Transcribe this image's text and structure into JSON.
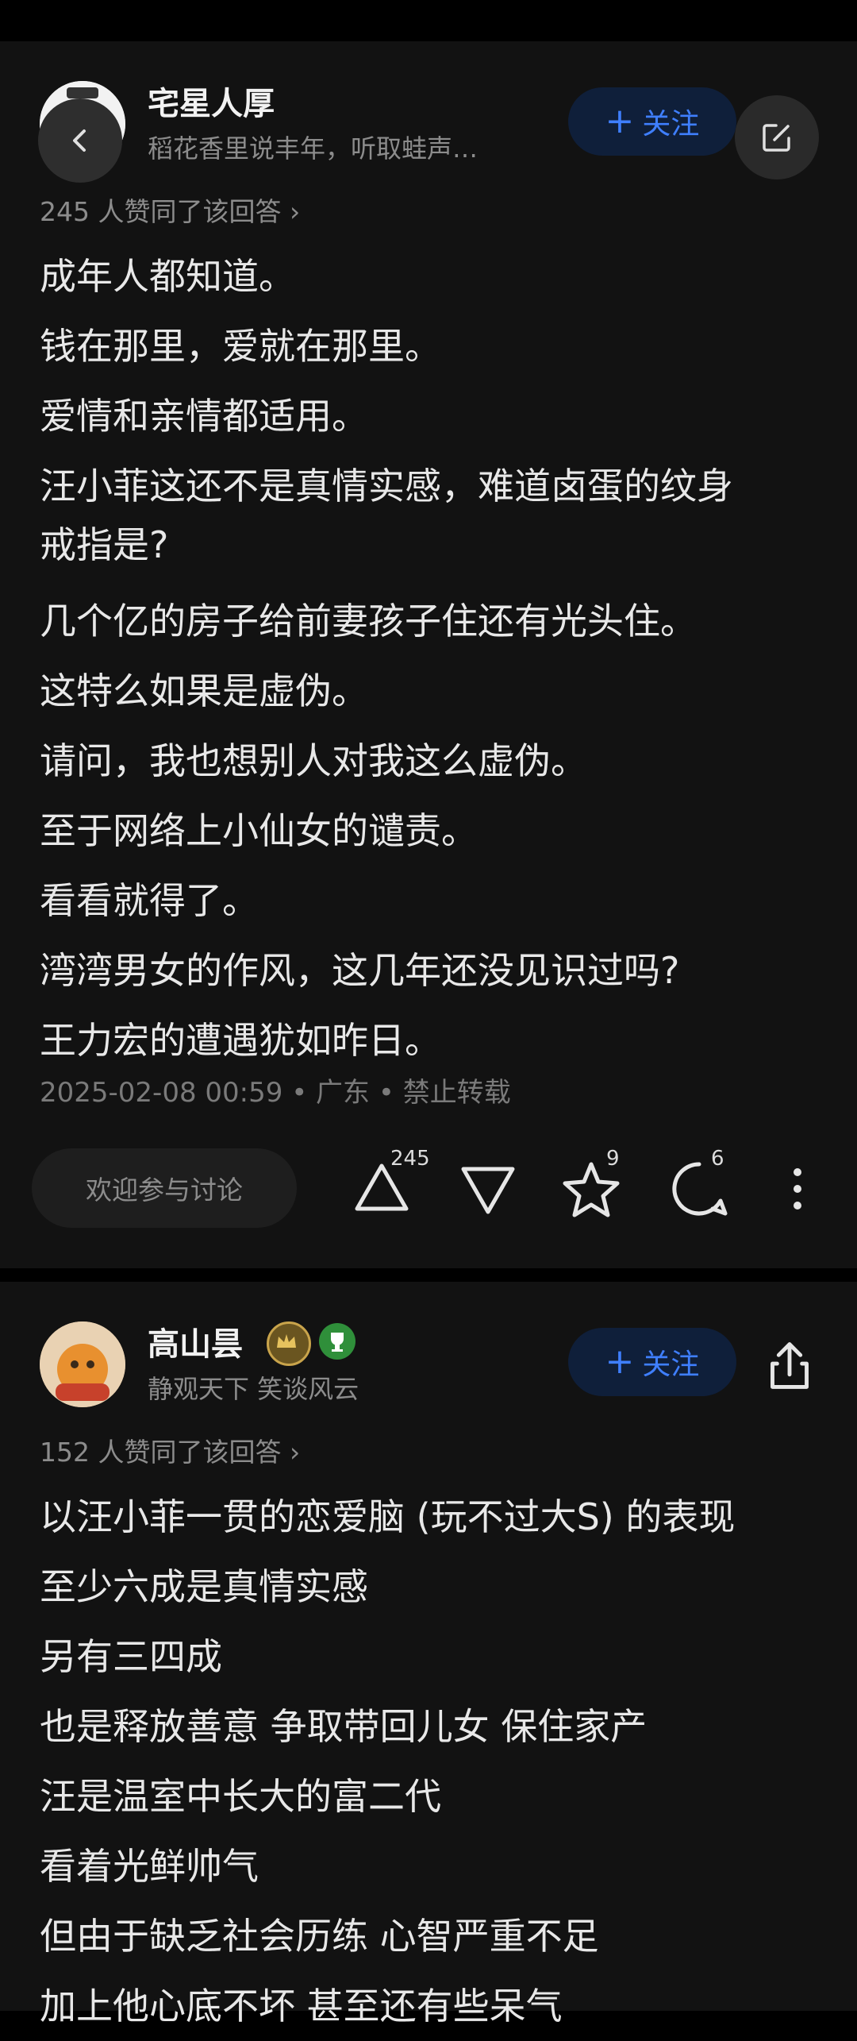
{
  "answer1": {
    "author_name": "宅星人厚",
    "author_bio": "稻花香里说丰年，听取蛙声…",
    "follow_label": "关注",
    "likes_text": "245 人赞同了该回答 ›",
    "lines": [
      "成年人都知道。",
      "钱在那里，爱就在那里。",
      "爱情和亲情都适用。",
      "汪小菲这还不是真情实感，难道卤蛋的纹身",
      "戒指是?",
      "几个亿的房子给前妻孩子住还有光头住。",
      "这特么如果是虚伪。",
      "请问，我也想别人对我这么虚伪。",
      "至于网络上小仙女的谴责。",
      "看看就得了。",
      "湾湾男女的作风，这几年还没见识过吗?",
      "王力宏的遭遇犹如昨日。"
    ],
    "meta": "2025-02-08 00:59 • 广东 • 禁止转载",
    "discuss_placeholder": "欢迎参与讨论",
    "upvote_count": "245",
    "favorite_count": "9",
    "comment_count": "6"
  },
  "answer2": {
    "author_name": "高山昙",
    "author_bio": "静观天下 笑谈风云",
    "follow_label": "关注",
    "likes_text": "152 人赞同了该回答 ›",
    "lines": [
      "以汪小菲一贯的恋爱脑 (玩不过大S) 的表现",
      "至少六成是真情实感",
      "另有三四成",
      "也是释放善意 争取带回儿女 保住家产",
      "汪是温室中长大的富二代",
      "看着光鲜帅气",
      "但由于缺乏社会历练 心智严重不足",
      "加上他心底不坏 甚至还有些呆气"
    ]
  },
  "colors": {
    "accent": "#3f7fff",
    "card_bg": "#121212",
    "page_bg": "#000000"
  },
  "icons": [
    "back-icon",
    "edit-icon",
    "upvote-icon",
    "downvote-icon",
    "star-icon",
    "comment-icon",
    "more-icon",
    "share-icon",
    "crown-badge-icon",
    "trophy-badge-icon"
  ]
}
